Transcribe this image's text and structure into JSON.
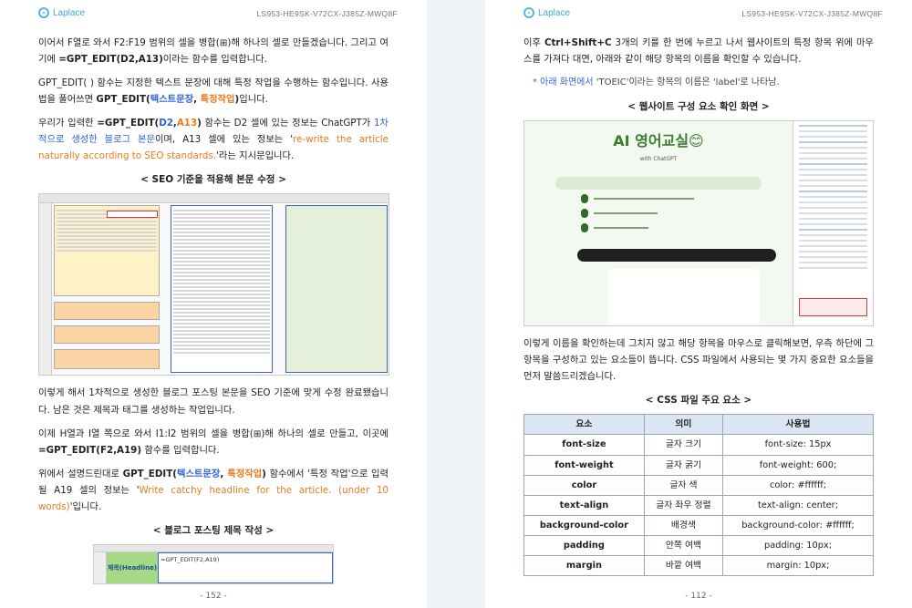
{
  "brand": "Laplace",
  "left_page": {
    "code": "LS953-HE9SK-V72CX-J385Z-MWQ8F",
    "p1_a": "이어서 F열로 와서 F2:F19 범위의 셀을 병합(",
    "p1_b": ")해 하나의 셀로 만들겠습니다. 그리고 여기에 ",
    "p1_formula": "=GPT_EDIT(D2,A13)",
    "p1_c": "이라는 함수를 입력합니다.",
    "p2_a": "GPT_EDIT( ) 함수는 지정한 텍스트 문장에 대해 특정 작업을 수행하는 함수입니다. 사용법을 풀어쓰면 ",
    "p2_fn": "GPT_EDIT(",
    "p2_arg1": "텍스트문장",
    "p2_sep": ", ",
    "p2_arg2": "특정작업",
    "p2_close": ")",
    "p2_end": "입니다.",
    "p3_a": "우리가 입력한 ",
    "p3_fx1": "=GPT_EDIT(",
    "p3_d2": "D2",
    "p3_comma": ",",
    "p3_a13": "A13",
    "p3_fx2": ")",
    "p3_b": " 함수는 D2 셀에 있는 정보는 ChatGPT가 ",
    "p3_blue": "1차적으로 생성한 블로그 본문",
    "p3_c": "이며, A13 셀에 있는 정보는 '",
    "p3_orange": "re-write the article naturally according to SEO standards.",
    "p3_d": "'라는 지시문입니다.",
    "caption1": "< SEO 기준을 적용해 본문 수정 >",
    "p4": "이렇게 해서 1차적으로 생성한 블로그 포스팅 본문을 SEO 기준에 맞게 수정 완료됐습니다. 남은 것은 제목과 태그를 생성하는 작업입니다.",
    "p5_a": "이제 H열과 I열 쪽으로 와서 I1:I2 범위의 셀을 병합(",
    "p5_b": ")해 하나의 셀로 만들고, 이곳에 ",
    "p5_formula": "=GPT_EDIT(F2,A19)",
    "p5_c": " 함수를 입력합니다.",
    "p6_a": "위에서 설명드린대로 ",
    "p6_fn": "GPT_EDIT(",
    "p6_arg1": "텍스트문장",
    "p6_sep": ", ",
    "p6_arg2": "특정작업",
    "p6_close": ")",
    "p6_b": " 함수에서 '특정 작업'으로 입력될 A19 셀의 정보는 '",
    "p6_orange": "Write catchy headline for the article. (under 10 words)",
    "p6_c": "'입니다.",
    "caption2": "< 블로그 포스팅 제목 작성 >",
    "mini_label": "제목(Headline)",
    "mini_formula": "=GPT_EDIT(F2,A19)",
    "page_number": "- 152 -"
  },
  "right_page": {
    "code": "LS953-HE9SK-V72CX-J385Z-MWQ8F",
    "p1_a": "이후 ",
    "p1_keys": "Ctrl+Shift+C",
    "p1_b": " 3개의 키를 한 번에 누르고 나서 웹사이트의 특정 항목 위에 마우스를 가져다 대면, 아래와 같이 해당 항목의 이름을 확인할 수 있습니다.",
    "note_a": "* 아래 화면에서 ",
    "note_b": "'TOEIC'이라는 항목의 이름은 'label'로 나타남.",
    "caption1": "< 웹사이트 구성 요소 확인 화면 >",
    "web_title": "AI 영어교실😊",
    "web_sub": "with ChatGPT",
    "p2": "이렇게 이름을 확인하는데 그치지 않고 해당 항목을 마우스로 클릭해보면, 우측 하단에 그 항목을 구성하고 있는 요소들이 뜹니다. CSS 파일에서 사용되는 몇 가지 중요한 요소들을 먼저 말씀드리겠습니다.",
    "caption2": "< CSS 파일 주요 요소 >",
    "table_headers": [
      "요소",
      "의미",
      "사용법"
    ],
    "table_rows": [
      [
        "font-size",
        "글자 크기",
        "font-size: 15px"
      ],
      [
        "font-weight",
        "글자 굵기",
        "font-weight: 600;"
      ],
      [
        "color",
        "글자 색",
        "color: #ffffff;"
      ],
      [
        "text-align",
        "글자 좌우 정렬",
        "text-align: center;"
      ],
      [
        "background-color",
        "배경색",
        "background-color: #ffffff;"
      ],
      [
        "padding",
        "안쪽 여백",
        "padding: 10px;"
      ],
      [
        "margin",
        "바깥 여백",
        "margin: 10px;"
      ]
    ],
    "page_number": "- 112 -"
  }
}
